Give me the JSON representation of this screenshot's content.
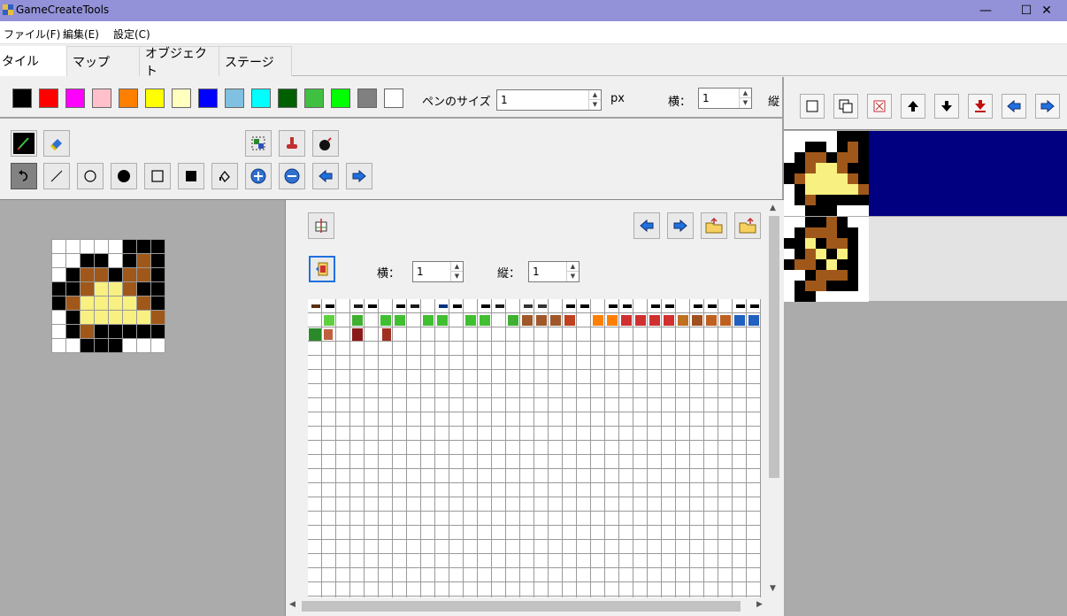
{
  "window": {
    "title": "GameCreateTools",
    "minimize": "—",
    "maximize": "☐",
    "close": "✕"
  },
  "menu": {
    "file": "ファイル(F)",
    "edit": "編集(E)",
    "settings": "設定(C)"
  },
  "tabs": [
    "タイル",
    "マップ",
    "オブジェクト",
    "ステージ"
  ],
  "palette": [
    "#000000",
    "#ff0000",
    "#ff00ff",
    "#ffc0cb",
    "#ff8000",
    "#ffff00",
    "#ffffc0",
    "#0000ff",
    "#80c0e0",
    "#00ffff",
    "#006000",
    "#40c040",
    "#00ff00",
    "#808080",
    "#ffffff"
  ],
  "pen": {
    "label": "ペンのサイズ",
    "value": "1",
    "unit": "px"
  },
  "size_top": {
    "width_label": "横：",
    "width_value": "1",
    "height_label": "縦"
  },
  "tools_row1": [
    "pencil-icon",
    "eraser-icon",
    "select-region-icon",
    "fill-bucket-icon",
    "bomb-icon"
  ],
  "tools_row2": [
    "undo-icon",
    "line-icon",
    "circle-outline-icon",
    "circle-filled-icon",
    "rect-outline-icon",
    "rect-filled-icon",
    "fill-icon",
    "zoom-in-icon",
    "zoom-out-icon",
    "arrow-left-icon",
    "arrow-right-icon"
  ],
  "tile_panel": {
    "width_label": "横：",
    "width_value": "1",
    "height_label": "縦：",
    "height_value": "1"
  },
  "right_toolbar": [
    "new-icon",
    "copy-icon",
    "delete-icon",
    "move-up-icon",
    "move-down-icon",
    "move-bottom-icon",
    "arrow-left-icon",
    "arrow-right-icon"
  ],
  "colors": {
    "selection": "#000080",
    "title_bar": "#9391d8"
  }
}
